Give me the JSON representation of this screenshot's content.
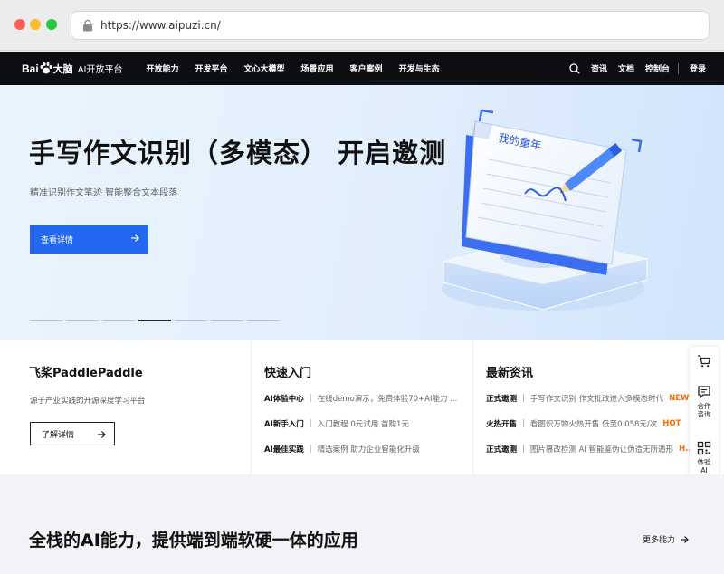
{
  "browser": {
    "url": "https://www.aipuzi.cn/"
  },
  "nav": {
    "logo_bai": "Bai",
    "logo_du": "大脑",
    "logo_sub": "AI开放平台",
    "items": [
      "开放能力",
      "开发平台",
      "文心大模型",
      "场景应用",
      "客户案例",
      "开发与生态"
    ],
    "right_items": [
      "资讯",
      "文档",
      "控制台",
      "登录"
    ]
  },
  "hero": {
    "title": "手写作文识别（多模态） 开启邀测",
    "subtitle": "精准识别作文笔迹 智能整合文本段落",
    "button": "查看详情",
    "art_text": "我的童年",
    "slide_count": 7,
    "active_slide": 4
  },
  "panels": {
    "paddle": {
      "title": "飞桨PaddlePaddle",
      "desc": "源于产业实践的开源深度学习平台",
      "button": "了解详情"
    },
    "quickstart": {
      "title": "快速入门",
      "rows": [
        {
          "key": "AI体验中心",
          "value": "在线demo演示，免费体验70+AI能力 ..."
        },
        {
          "key": "AI新手入门",
          "value": "入门教程 0元试用 首购1元"
        },
        {
          "key": "AI最佳实践",
          "value": "精选案例 助力企业智能化升级"
        }
      ]
    },
    "news": {
      "title": "最新资讯",
      "rows": [
        {
          "key": "正式邀测",
          "value": "手写作文识别 作文批改进入多模态时代",
          "tag": "NEW"
        },
        {
          "key": "火热开售",
          "value": "看图识万物火热开售 低至0.058元/次",
          "tag": "HOT"
        },
        {
          "key": "正式邀测",
          "value": "图片篡改检测 AI 智能鉴伪让伪造无所遁形",
          "tag": "H..."
        }
      ]
    }
  },
  "float_bar": {
    "cart_icon": "cart-icon",
    "consult_label": "合作咨询",
    "qr_label": "体验AI"
  },
  "bottom": {
    "title": "全栈的AI能力，提供端到端软硬一体的应用",
    "more": "更多能力"
  },
  "colors": {
    "primary": "#2468f2",
    "nav_bg": "#0d0e12",
    "hot": "#ff6a00"
  }
}
